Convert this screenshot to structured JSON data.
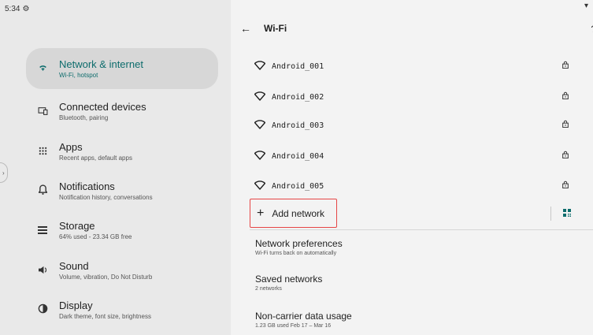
{
  "status": {
    "time": "5:34",
    "time_icon": "settings-gear-icon"
  },
  "sidebar": {
    "items": [
      {
        "title": "Network & internet",
        "subtitle": "Wi-Fi, hotspot",
        "icon": "wifi-icon",
        "active": true
      },
      {
        "title": "Connected devices",
        "subtitle": "Bluetooth, pairing",
        "icon": "devices-icon"
      },
      {
        "title": "Apps",
        "subtitle": "Recent apps, default apps",
        "icon": "apps-grid-icon"
      },
      {
        "title": "Notifications",
        "subtitle": "Notification history, conversations",
        "icon": "bell-icon"
      },
      {
        "title": "Storage",
        "subtitle": "64% used - 23.34 GB free",
        "icon": "storage-icon"
      },
      {
        "title": "Sound",
        "subtitle": "Volume, vibration, Do Not Disturb",
        "icon": "volume-icon"
      },
      {
        "title": "Display",
        "subtitle": "Dark theme, font size, brightness",
        "icon": "brightness-icon"
      }
    ]
  },
  "wifi": {
    "title": "Wi-Fi",
    "networks": [
      {
        "name": "Android_001"
      },
      {
        "name": "Android_002"
      },
      {
        "name": "Android_003"
      },
      {
        "name": "Android_004"
      },
      {
        "name": "Android_005"
      }
    ],
    "add_network": "Add network",
    "preferences": [
      {
        "title": "Network preferences",
        "subtitle": "Wi-Fi turns back on automatically"
      },
      {
        "title": "Saved networks",
        "subtitle": "2 networks"
      },
      {
        "title": "Non-carrier data usage",
        "subtitle": "1.23 GB used Feb 17 – Mar 16"
      }
    ]
  },
  "colors": {
    "accent": "#0d6c6c",
    "highlight_border": "#e64545"
  }
}
